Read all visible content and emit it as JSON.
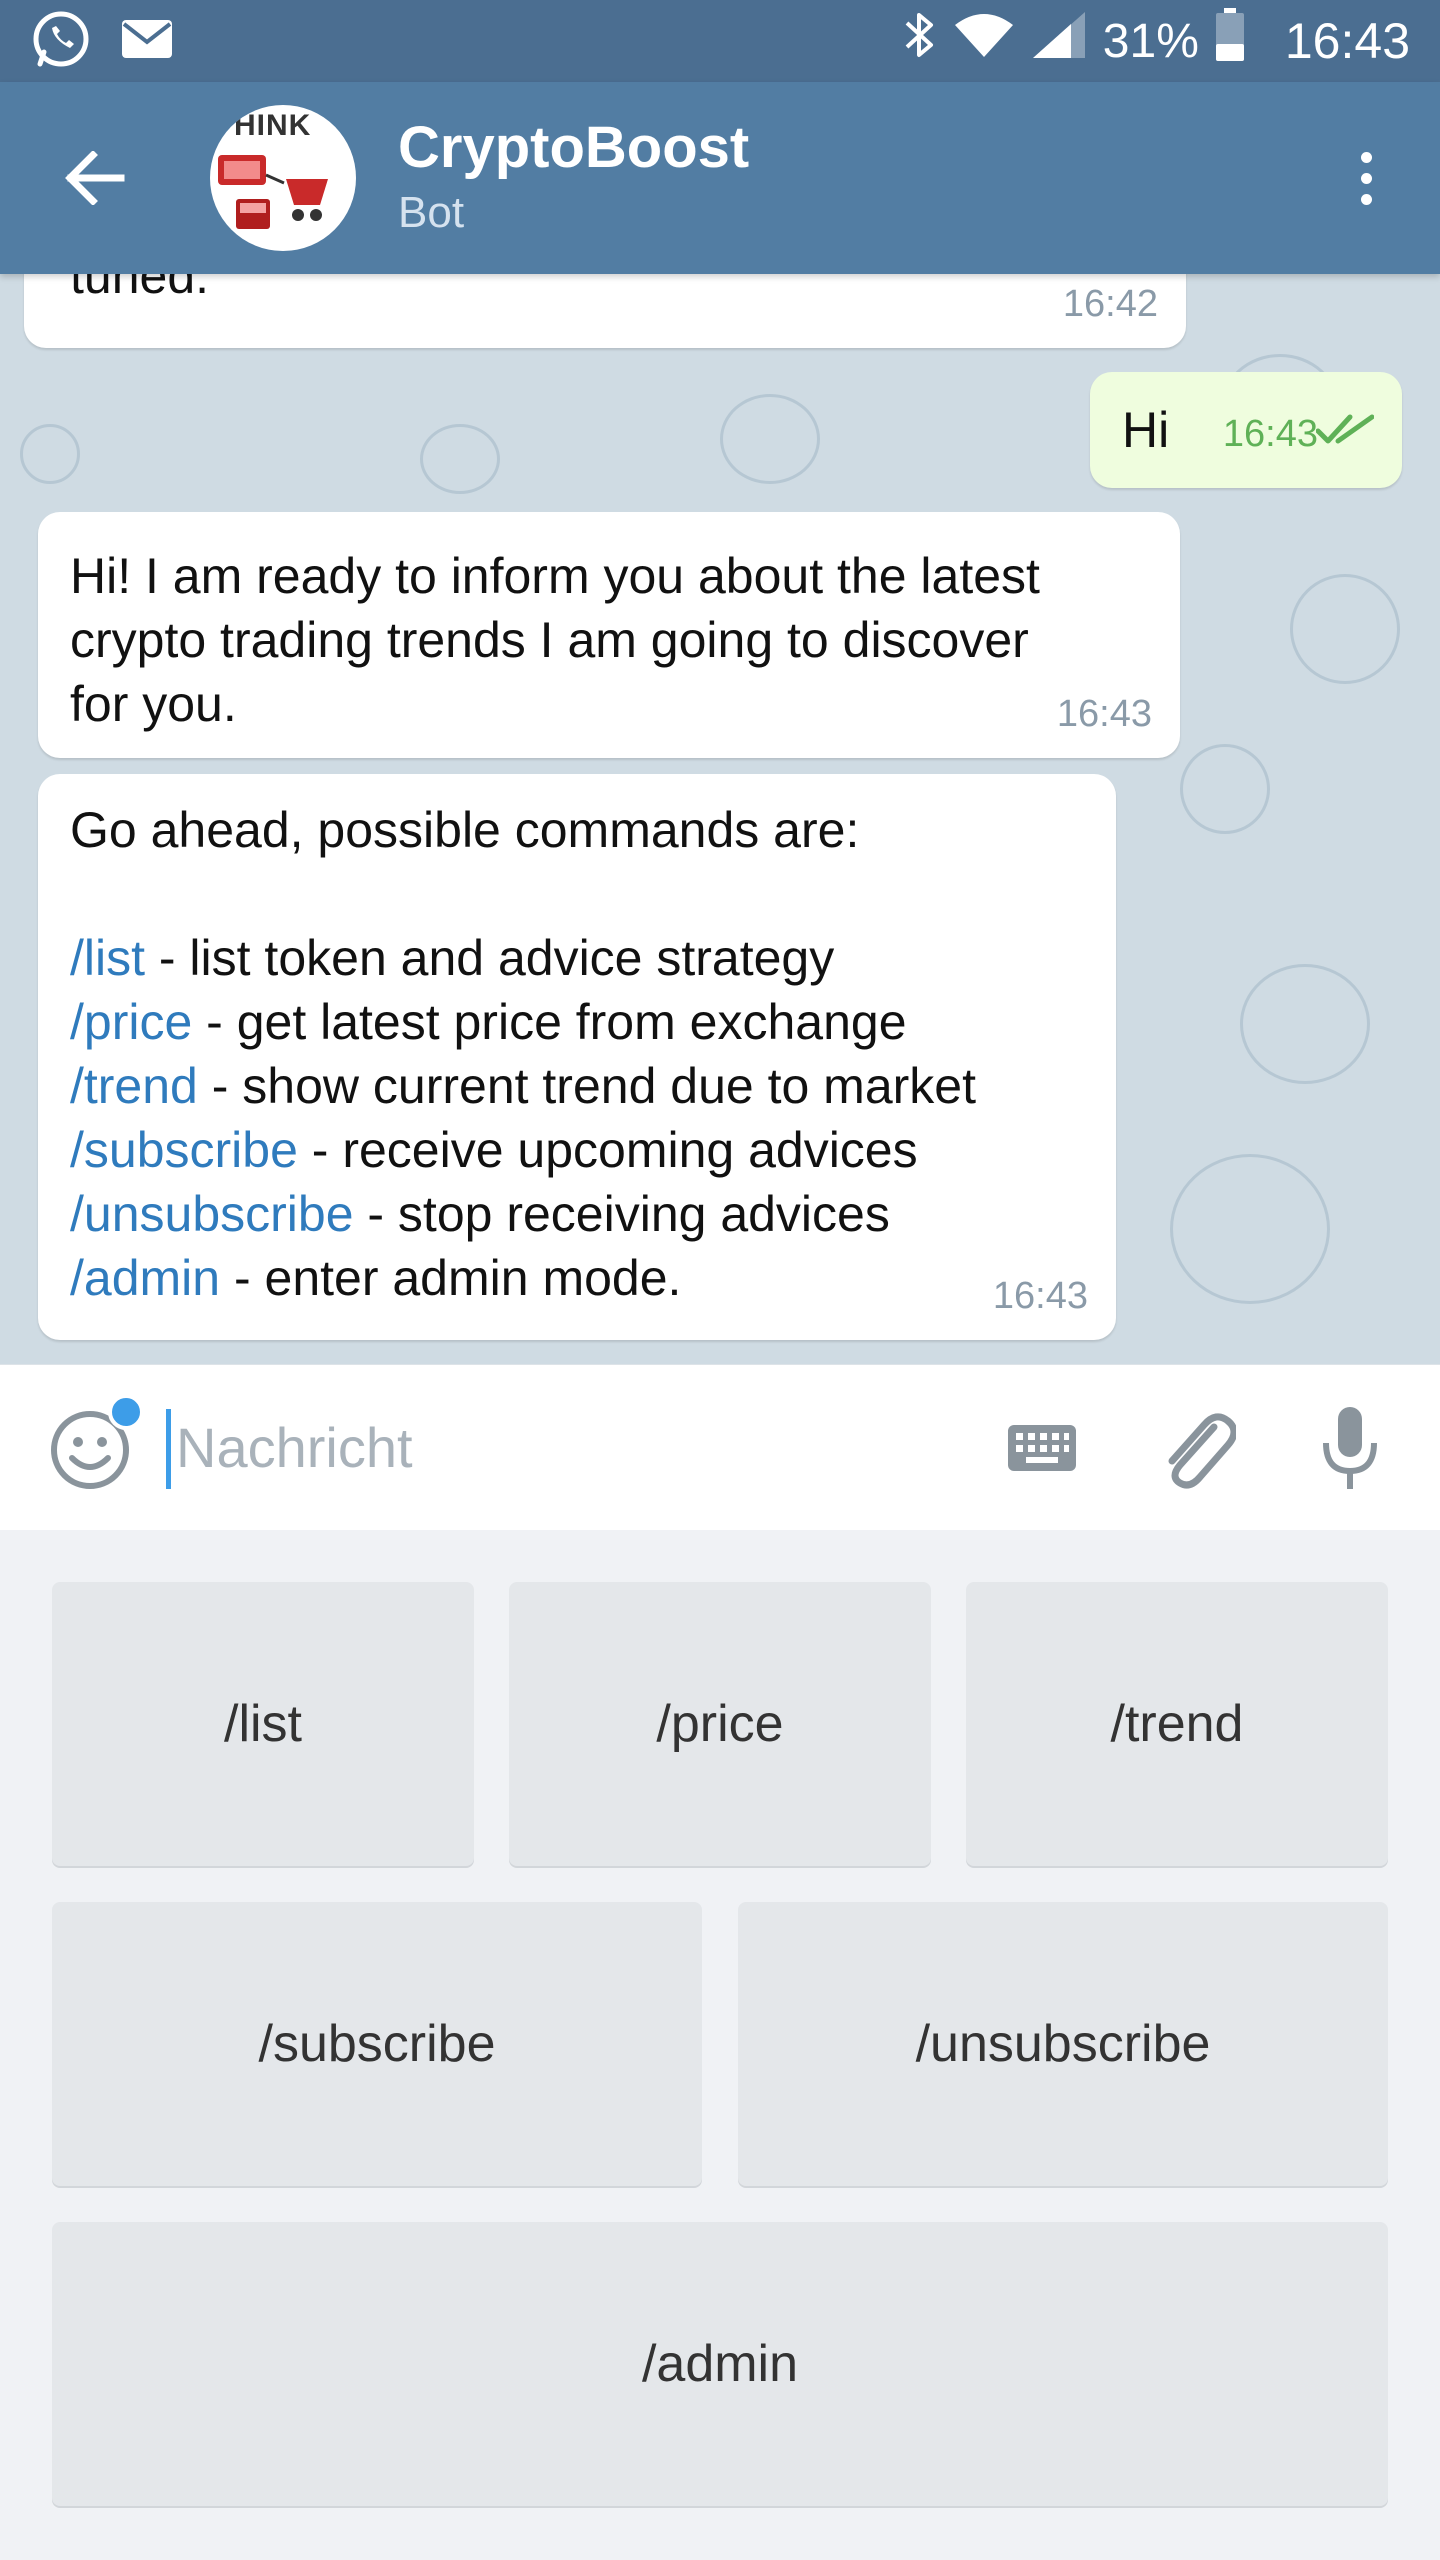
{
  "status_bar": {
    "battery_pct": "31%",
    "clock": "16:43",
    "left_icons": [
      "whatsapp-icon",
      "mail-icon"
    ],
    "right_icons": [
      "bluetooth-icon",
      "wifi-icon",
      "signal-icon",
      "battery-icon"
    ]
  },
  "header": {
    "title": "CryptoBoost",
    "subtitle": "Bot",
    "avatar_text": "HINK"
  },
  "messages": [
    {
      "direction": "in",
      "text": "tuned.",
      "time": "16:42"
    },
    {
      "direction": "out",
      "text": "Hi",
      "time": "16:43",
      "status": "read"
    },
    {
      "direction": "in",
      "lines": [
        "Hi! I am ready to inform you about the latest",
        "crypto trading trends I am going to discover",
        "for you."
      ],
      "time": "16:43"
    },
    {
      "direction": "in",
      "intro": "Go ahead, possible commands are:",
      "commands": [
        {
          "cmd": "/list",
          "desc": " - list token and advice strategy"
        },
        {
          "cmd": "/price",
          "desc": " - get latest price from exchange"
        },
        {
          "cmd": "/trend",
          "desc": " - show current trend due to market"
        },
        {
          "cmd": "/subscribe",
          "desc": " - receive upcoming advices"
        },
        {
          "cmd": "/unsubscribe",
          "desc": " - stop receiving advices"
        },
        {
          "cmd": "/admin",
          "desc": " - enter admin mode."
        }
      ],
      "time": "16:43"
    }
  ],
  "input": {
    "placeholder": "Nachricht",
    "value": ""
  },
  "keyboard": {
    "rows": [
      [
        "/list",
        "/price",
        "/trend"
      ],
      [
        "/subscribe",
        "/unsubscribe"
      ],
      [
        "/admin"
      ]
    ]
  },
  "colors": {
    "status_bar": "#4b6e91",
    "app_bar": "#527da3",
    "chat_bg": "#cfdbe3",
    "outgoing_bubble": "#effdde",
    "command_link": "#2f7bbd",
    "accent": "#3d9de8"
  }
}
